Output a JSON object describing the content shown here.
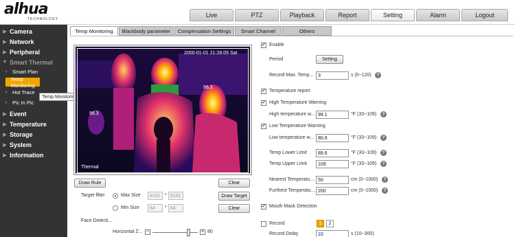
{
  "header": {
    "logo": "alhua",
    "logo_sub": "TECHNOLOGY",
    "tabs": [
      "Live",
      "PTZ",
      "Playback",
      "Report",
      "Setting",
      "Alarm",
      "Logout"
    ]
  },
  "sidebar": {
    "items": [
      "Camera",
      "Network",
      "Peripheral",
      "Smart Thermal",
      "Event",
      "Temperature",
      "Storage",
      "System",
      "Information"
    ],
    "sub_items": [
      "Smart Plan",
      "Temp Monitoring",
      "Hot Trace",
      "Pic In Pic"
    ],
    "tooltip": "Temp Monitoring"
  },
  "subtabs": [
    "Temp Monitoring",
    "Blackbody parameter",
    "Compensation Settings",
    "Smart Channel",
    "Others"
  ],
  "video": {
    "timestamp": "2000-01-01 21:28:05 Sat",
    "label": "Thermal",
    "temp1": "96.3",
    "temp2": "96.3"
  },
  "left_controls": {
    "draw_rule": "Draw Rule",
    "clear": "Clear",
    "target_filter": "Target filter",
    "max_size": "Max Size",
    "max_w": "8191",
    "max_h": "8191",
    "draw_target": "Draw Target",
    "min_size": "Min Size",
    "min_w": "64",
    "min_h": "64",
    "clear2": "Clear",
    "face_detect": "Face Detecti...",
    "horizontal": "Horizontal Z...",
    "slider_minus": "−",
    "slider_plus": "+",
    "slider_value": "80",
    "sep": "*",
    "slider_level": 0.8
  },
  "right_panel": {
    "enable": "Enable",
    "period": "Period",
    "setting": "Setting",
    "record_max_temp": "Record Max. Temp...",
    "record_max_temp_val": "3",
    "record_max_temp_unit": "s (0~120)",
    "temperature_report": "Temperature report",
    "high_temp_warning": "High Temperature Warning",
    "high_temp_w": "High temperature w...",
    "high_temp_val": "99.1",
    "high_temp_unit": "°F (33~109)",
    "low_temp_warning": "Low Temperature Warning",
    "low_temp_w": "Low temperature w...",
    "low_temp_val": "80.6",
    "low_temp_unit": "°F (33~109)",
    "temp_lower_limit": "Temp Lower Limit",
    "temp_lower_val": "89.6",
    "temp_lower_unit": "°F (33~109)",
    "temp_upper_limit": "Temp Upper Limit",
    "temp_upper_val": "109",
    "temp_upper_unit": "°F (33~109)",
    "nearest": "Nearest Temperatu...",
    "nearest_val": "50",
    "nearest_unit": "cm (0~1000)",
    "furthest": "Furthest Temperatu...",
    "furthest_val": "200",
    "furthest_unit": "cm (0~1000)",
    "mouth_mask": "Mouth Mask Detection",
    "record": "Record",
    "record_page1": "1",
    "record_page2": "2",
    "record_delay": "Record Delay",
    "record_delay_val": "10",
    "record_delay_unit": "s (10~300)",
    "help": "?",
    "check": "✓"
  }
}
